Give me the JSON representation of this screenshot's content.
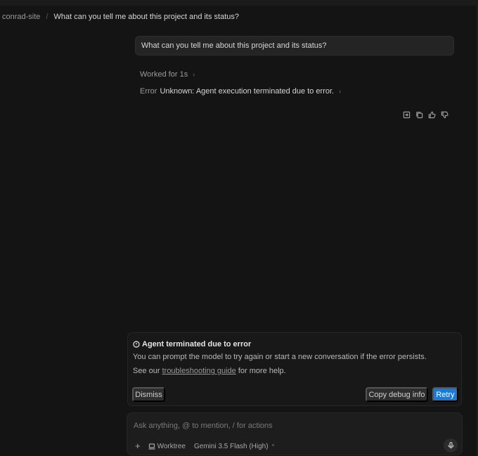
{
  "breadcrumb": {
    "project": "conrad-site",
    "separator": "/",
    "title": "What can you tell me about this project and its status?"
  },
  "conversation": {
    "user_message": "What can you tell me about this project and its status?",
    "worked_label": "Worked for 1s",
    "error_label": "Error",
    "error_message": "Unknown: Agent execution terminated due to error.",
    "message_actions": [
      "insert-icon",
      "copy-icon",
      "thumbs-up-icon",
      "thumbs-down-icon"
    ]
  },
  "error_card": {
    "icon": "alert-circle-icon",
    "title": "Agent terminated due to error",
    "description": "You can prompt the model to try again or start a new conversation if the error persists.",
    "help_prefix": "See our ",
    "help_link": "troubleshooting guide",
    "help_suffix": " for more help.",
    "dismiss_label": "Dismiss",
    "copy_debug_label": "Copy debug info",
    "retry_label": "Retry"
  },
  "composer": {
    "placeholder": "Ask anything, @ to mention, / for actions",
    "add_icon": "+",
    "worktree_label": "Worktree",
    "model_label": "Gemini 3.5 Flash (High)",
    "model_caret": "^"
  },
  "colors": {
    "background": "#141414",
    "accent": "#1a7ad8",
    "card": "#181818",
    "button": "#2e2e2e"
  }
}
